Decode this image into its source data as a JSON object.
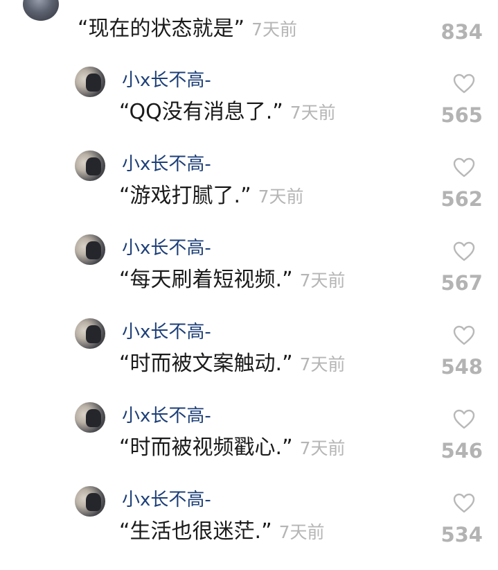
{
  "top_comment": {
    "text": "“现在的状态就是”",
    "time": "7天前",
    "likes": "834"
  },
  "replies": [
    {
      "username": "小x长不高-",
      "text": "“QQ没有消息了.”",
      "time": "7天前",
      "likes": "565"
    },
    {
      "username": "小x长不高-",
      "text": "“游戏打腻了.”",
      "time": "7天前",
      "likes": "562"
    },
    {
      "username": "小x长不高-",
      "text": "“每天刷着短视频.”",
      "time": "7天前",
      "likes": "567"
    },
    {
      "username": "小x长不高-",
      "text": "“时而被文案触动.”",
      "time": "7天前",
      "likes": "548"
    },
    {
      "username": "小x长不高-",
      "text": "“时而被视频戳心.”",
      "time": "7天前",
      "likes": "546"
    },
    {
      "username": "小x长不高-",
      "text": "“生活也很迷茫.”",
      "time": "7天前",
      "likes": "534"
    }
  ],
  "colors": {
    "username": "#1d3f78",
    "text": "#1a1a1a",
    "muted": "#b5b5b5"
  },
  "icons": {
    "like": "heart-outline-icon"
  }
}
